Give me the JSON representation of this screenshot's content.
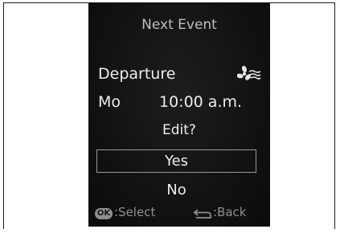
{
  "screen": {
    "title": "Next Event",
    "departure_label": "Departure",
    "fan_icon": "fan-icon",
    "day": "Mo",
    "time": "10:00 a.m.",
    "prompt": "Edit?",
    "options": [
      {
        "label": "Yes",
        "selected": true
      },
      {
        "label": "No",
        "selected": false
      }
    ],
    "footer": {
      "ok_label": "OK",
      "select_text": ":Select",
      "back_text": ":Back"
    }
  }
}
